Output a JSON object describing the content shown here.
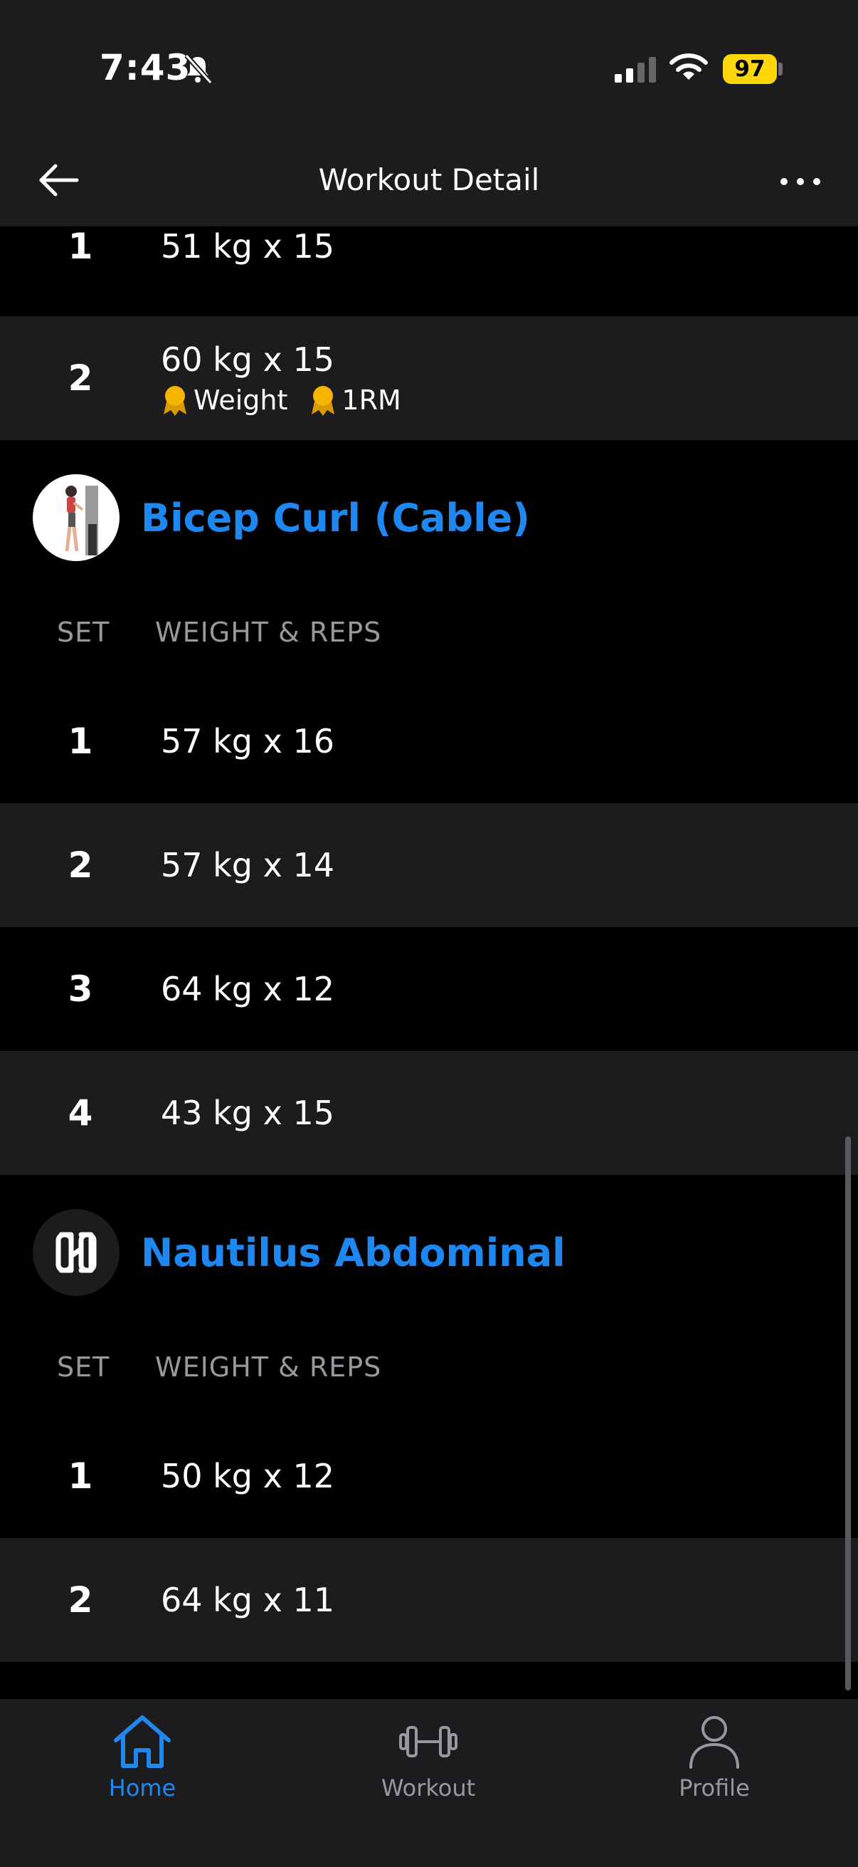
{
  "status_bar": {
    "time": "7:43",
    "battery": "97",
    "icons": [
      "bell-slash-icon",
      "cellular-signal-icon",
      "wifi-icon",
      "battery-icon"
    ]
  },
  "nav": {
    "title": "Workout Detail",
    "back_icon": "arrow-left-icon",
    "more_icon": "more-horizontal-icon"
  },
  "prev_exercise": {
    "sets": [
      {
        "num": "1",
        "value": "51 kg x 15"
      },
      {
        "num": "2",
        "value": "60 kg x 15",
        "badges": [
          "Weight",
          "1RM"
        ]
      }
    ]
  },
  "exercises": [
    {
      "name": "Bicep Curl (Cable)",
      "col_set": "SET",
      "col_weight": "WEIGHT & REPS",
      "sets": [
        {
          "num": "1",
          "value": "57 kg x 16"
        },
        {
          "num": "2",
          "value": "57 kg x 14"
        },
        {
          "num": "3",
          "value": "64 kg x 12"
        },
        {
          "num": "4",
          "value": "43 kg x 15"
        }
      ]
    },
    {
      "name": "Nautilus Abdominal",
      "col_set": "SET",
      "col_weight": "WEIGHT & REPS",
      "sets": [
        {
          "num": "1",
          "value": "50 kg x 12"
        },
        {
          "num": "2",
          "value": "64 kg x 11"
        }
      ]
    }
  ],
  "tabs": [
    {
      "label": "Home",
      "icon": "home-icon",
      "active": true
    },
    {
      "label": "Workout",
      "icon": "dumbbell-icon",
      "active": false
    },
    {
      "label": "Profile",
      "icon": "person-icon",
      "active": false
    }
  ],
  "colors": {
    "accent": "#1e88f0",
    "badge_gold": "#f5b400",
    "row_light": "#1c1c1e",
    "background": "#000000"
  }
}
